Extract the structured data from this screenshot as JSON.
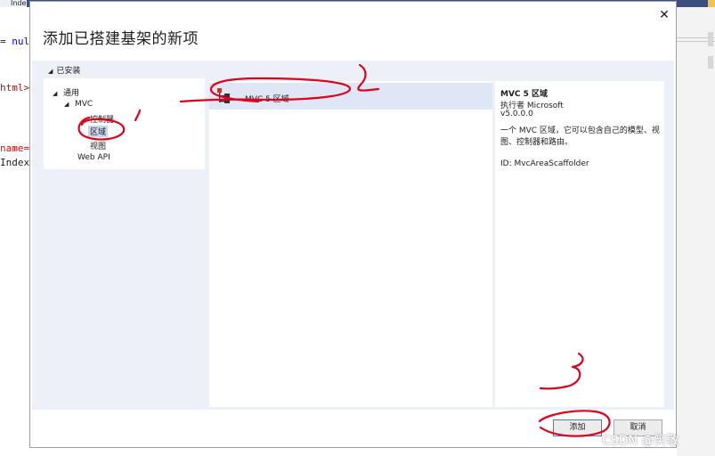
{
  "ide": {
    "tab_label": "Inde",
    "code_lines": {
      "line1_eq": "= ",
      "line1_kw": "nul",
      "line2": "html>",
      "line3_attr": "name=",
      "line3_val": "\"",
      "line4": "Index"
    }
  },
  "dialog": {
    "title": "添加已搭建基架的新项",
    "installed_label": "已安装",
    "tree": {
      "general": "通用",
      "mvc": "MVC",
      "controller": "控制器",
      "area": "区域",
      "view": "视图",
      "webapi": "Web API"
    },
    "list": {
      "items": [
        {
          "label": "MVC 5 区域"
        }
      ]
    },
    "detail": {
      "title": "MVC 5 区域",
      "publisher": "执行者 Microsoft",
      "version": "v5.0.0.0",
      "description": "一个 MVC 区域，它可以包含自己的模型、视图、控制器和路由。",
      "id": "ID: MvcAreaScaffolder"
    },
    "buttons": {
      "add": "添加",
      "cancel": "取消"
    }
  },
  "watermark": "CSDN @笑敬",
  "colors": {
    "selection": "#dfe6f5",
    "body_bg": "#eef0f7",
    "annotation": "#e0001b"
  }
}
